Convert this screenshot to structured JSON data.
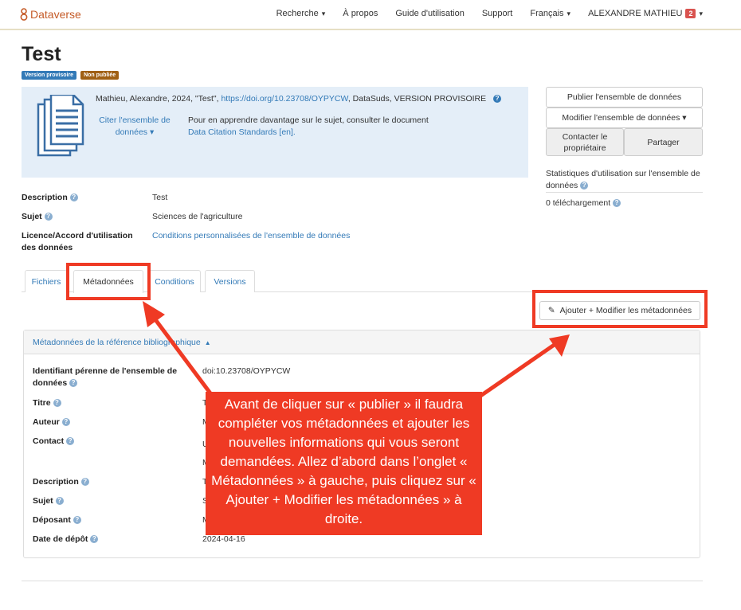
{
  "navbar": {
    "brand": "Dataverse",
    "items": [
      {
        "label": "Recherche",
        "dropdown": true
      },
      {
        "label": "À propos",
        "dropdown": false
      },
      {
        "label": "Guide d'utilisation",
        "dropdown": false
      },
      {
        "label": "Support",
        "dropdown": false
      },
      {
        "label": "Français",
        "dropdown": true
      }
    ],
    "user": {
      "name": "ALEXANDRE MATHIEU",
      "notifications": "2"
    }
  },
  "dataset": {
    "title": "Test",
    "labels": [
      "Version provisoire",
      "Non publiée"
    ],
    "citation": {
      "text": "Mathieu, Alexandre, 2024, \"Test\", ",
      "doi_link": "https://doi.org/10.23708/OYPYCW",
      "suffix": ", DataSuds, VERSION PROVISOIRE",
      "cite_label": "Citer l'ensemble de données",
      "more_text": "Pour en apprendre davantage sur le sujet, consulter le document",
      "standards_link": "Data Citation Standards [en]."
    }
  },
  "actions": {
    "publish": "Publier l'ensemble de données",
    "edit": "Modifier l'ensemble de données",
    "contact": "Contacter le propriétaire",
    "share": "Partager"
  },
  "stats": {
    "title": "Statistiques d'utilisation sur l'ensemble de données",
    "downloads": "0 téléchargement"
  },
  "summary": [
    {
      "label": "Description",
      "value": "Test",
      "is_link": false
    },
    {
      "label": "Sujet",
      "value": "Sciences de l'agriculture",
      "is_link": false
    },
    {
      "label": "Licence/Accord d'utilisation des données",
      "value": "Conditions personnalisées de l'ensemble de données",
      "is_link": true
    }
  ],
  "tabs": [
    {
      "label": "Fichiers",
      "active": false
    },
    {
      "label": "Métadonnées",
      "active": true
    },
    {
      "label": "Conditions",
      "active": false
    },
    {
      "label": "Versions",
      "active": false
    }
  ],
  "edit_metadata_button": "Ajouter + Modifier les métadonnées",
  "panel": {
    "title": "Métadonnées de la référence bibliographique",
    "rows": [
      {
        "label": "Identifiant pérenne de l'ensemble de données",
        "value": "doi:10.23708/OYPYCW"
      },
      {
        "label": "Titre",
        "value": "T"
      },
      {
        "label": "Auteur",
        "value": "M"
      },
      {
        "label": "Contact",
        "value": "U"
      },
      {
        "label": "",
        "value": "M"
      },
      {
        "label": "Description",
        "value": "T"
      },
      {
        "label": "Sujet",
        "value": "S"
      },
      {
        "label": "Déposant",
        "value": "M"
      },
      {
        "label": "Date de dépôt",
        "value": "2024-04-16"
      }
    ]
  },
  "annotation": {
    "callout": "Avant de cliquer sur « publier » il faudra compléter vos métadonnées et ajouter les nouvelles informations qui vous seront demandées. Allez d’abord dans l’onglet « Métadonnées » à gauche, puis cliquez sur « Ajouter + Modifier les métadonnées » à droite.",
    "color": "#ef3a24"
  }
}
